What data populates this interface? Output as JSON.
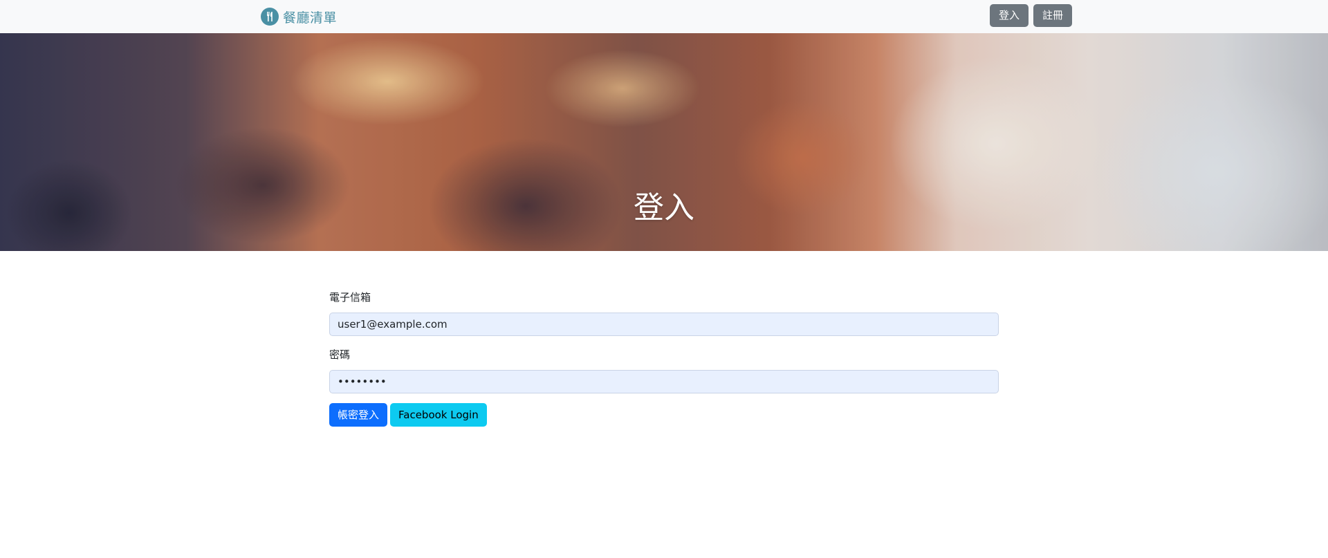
{
  "navbar": {
    "brand_label": "餐廳清單",
    "brand_icon": "utensils-icon",
    "login_label": "登入",
    "register_label": "註冊"
  },
  "hero": {
    "title": "登入"
  },
  "form": {
    "email_label": "電子信箱",
    "email_value": "user1@example.com",
    "password_label": "密碼",
    "password_value": "••••••••",
    "submit_label": "帳密登入",
    "facebook_label": "Facebook Login"
  },
  "colors": {
    "brand": "#4a90a4",
    "navbar_bg": "#f8f9fa",
    "secondary_button": "#6c757d",
    "primary_button": "#0d6efd",
    "info_button": "#0dcaf0",
    "autofill_bg": "#e8f0fe"
  }
}
